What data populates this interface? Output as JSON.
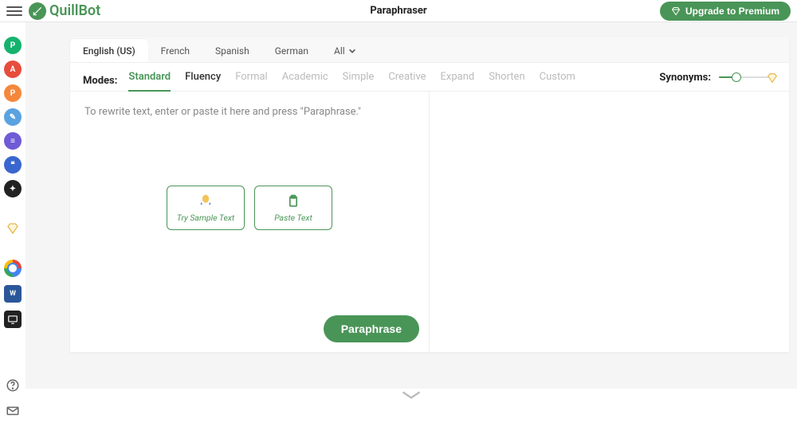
{
  "header": {
    "brand_name": "QuillBot",
    "page_title": "Paraphraser",
    "upgrade_label": "Upgrade to Premium"
  },
  "sidebar": {
    "tools": [
      {
        "id": "paraphraser",
        "color": "green",
        "glyph": "P"
      },
      {
        "id": "grammar",
        "color": "red",
        "glyph": "A"
      },
      {
        "id": "plagiarism",
        "color": "orange",
        "glyph": "P"
      },
      {
        "id": "cowriter",
        "color": "blue",
        "glyph": "✎"
      },
      {
        "id": "summarizer",
        "color": "purple",
        "glyph": "≡"
      },
      {
        "id": "citation",
        "color": "indigo",
        "glyph": "❝"
      },
      {
        "id": "translator",
        "color": "dark",
        "glyph": "✦"
      }
    ],
    "premium_id": "premium",
    "apps": [
      {
        "id": "chrome-ext"
      },
      {
        "id": "word-ext",
        "glyph": "W"
      },
      {
        "id": "mac-app"
      }
    ]
  },
  "languages": {
    "items": [
      "English (US)",
      "French",
      "Spanish",
      "German"
    ],
    "active_index": 0,
    "all_label": "All"
  },
  "modes": {
    "label": "Modes:",
    "items": [
      {
        "label": "Standard",
        "state": "active"
      },
      {
        "label": "Fluency",
        "state": "available"
      },
      {
        "label": "Formal",
        "state": "locked"
      },
      {
        "label": "Academic",
        "state": "locked"
      },
      {
        "label": "Simple",
        "state": "locked"
      },
      {
        "label": "Creative",
        "state": "locked"
      },
      {
        "label": "Expand",
        "state": "locked"
      },
      {
        "label": "Shorten",
        "state": "locked"
      },
      {
        "label": "Custom",
        "state": "locked"
      }
    ]
  },
  "synonyms": {
    "label": "Synonyms:"
  },
  "editor": {
    "placeholder": "To rewrite text, enter or paste it here and press \"Paraphrase.\"",
    "sample_btn": "Try Sample Text",
    "paste_btn": "Paste Text",
    "submit_btn": "Paraphrase"
  }
}
